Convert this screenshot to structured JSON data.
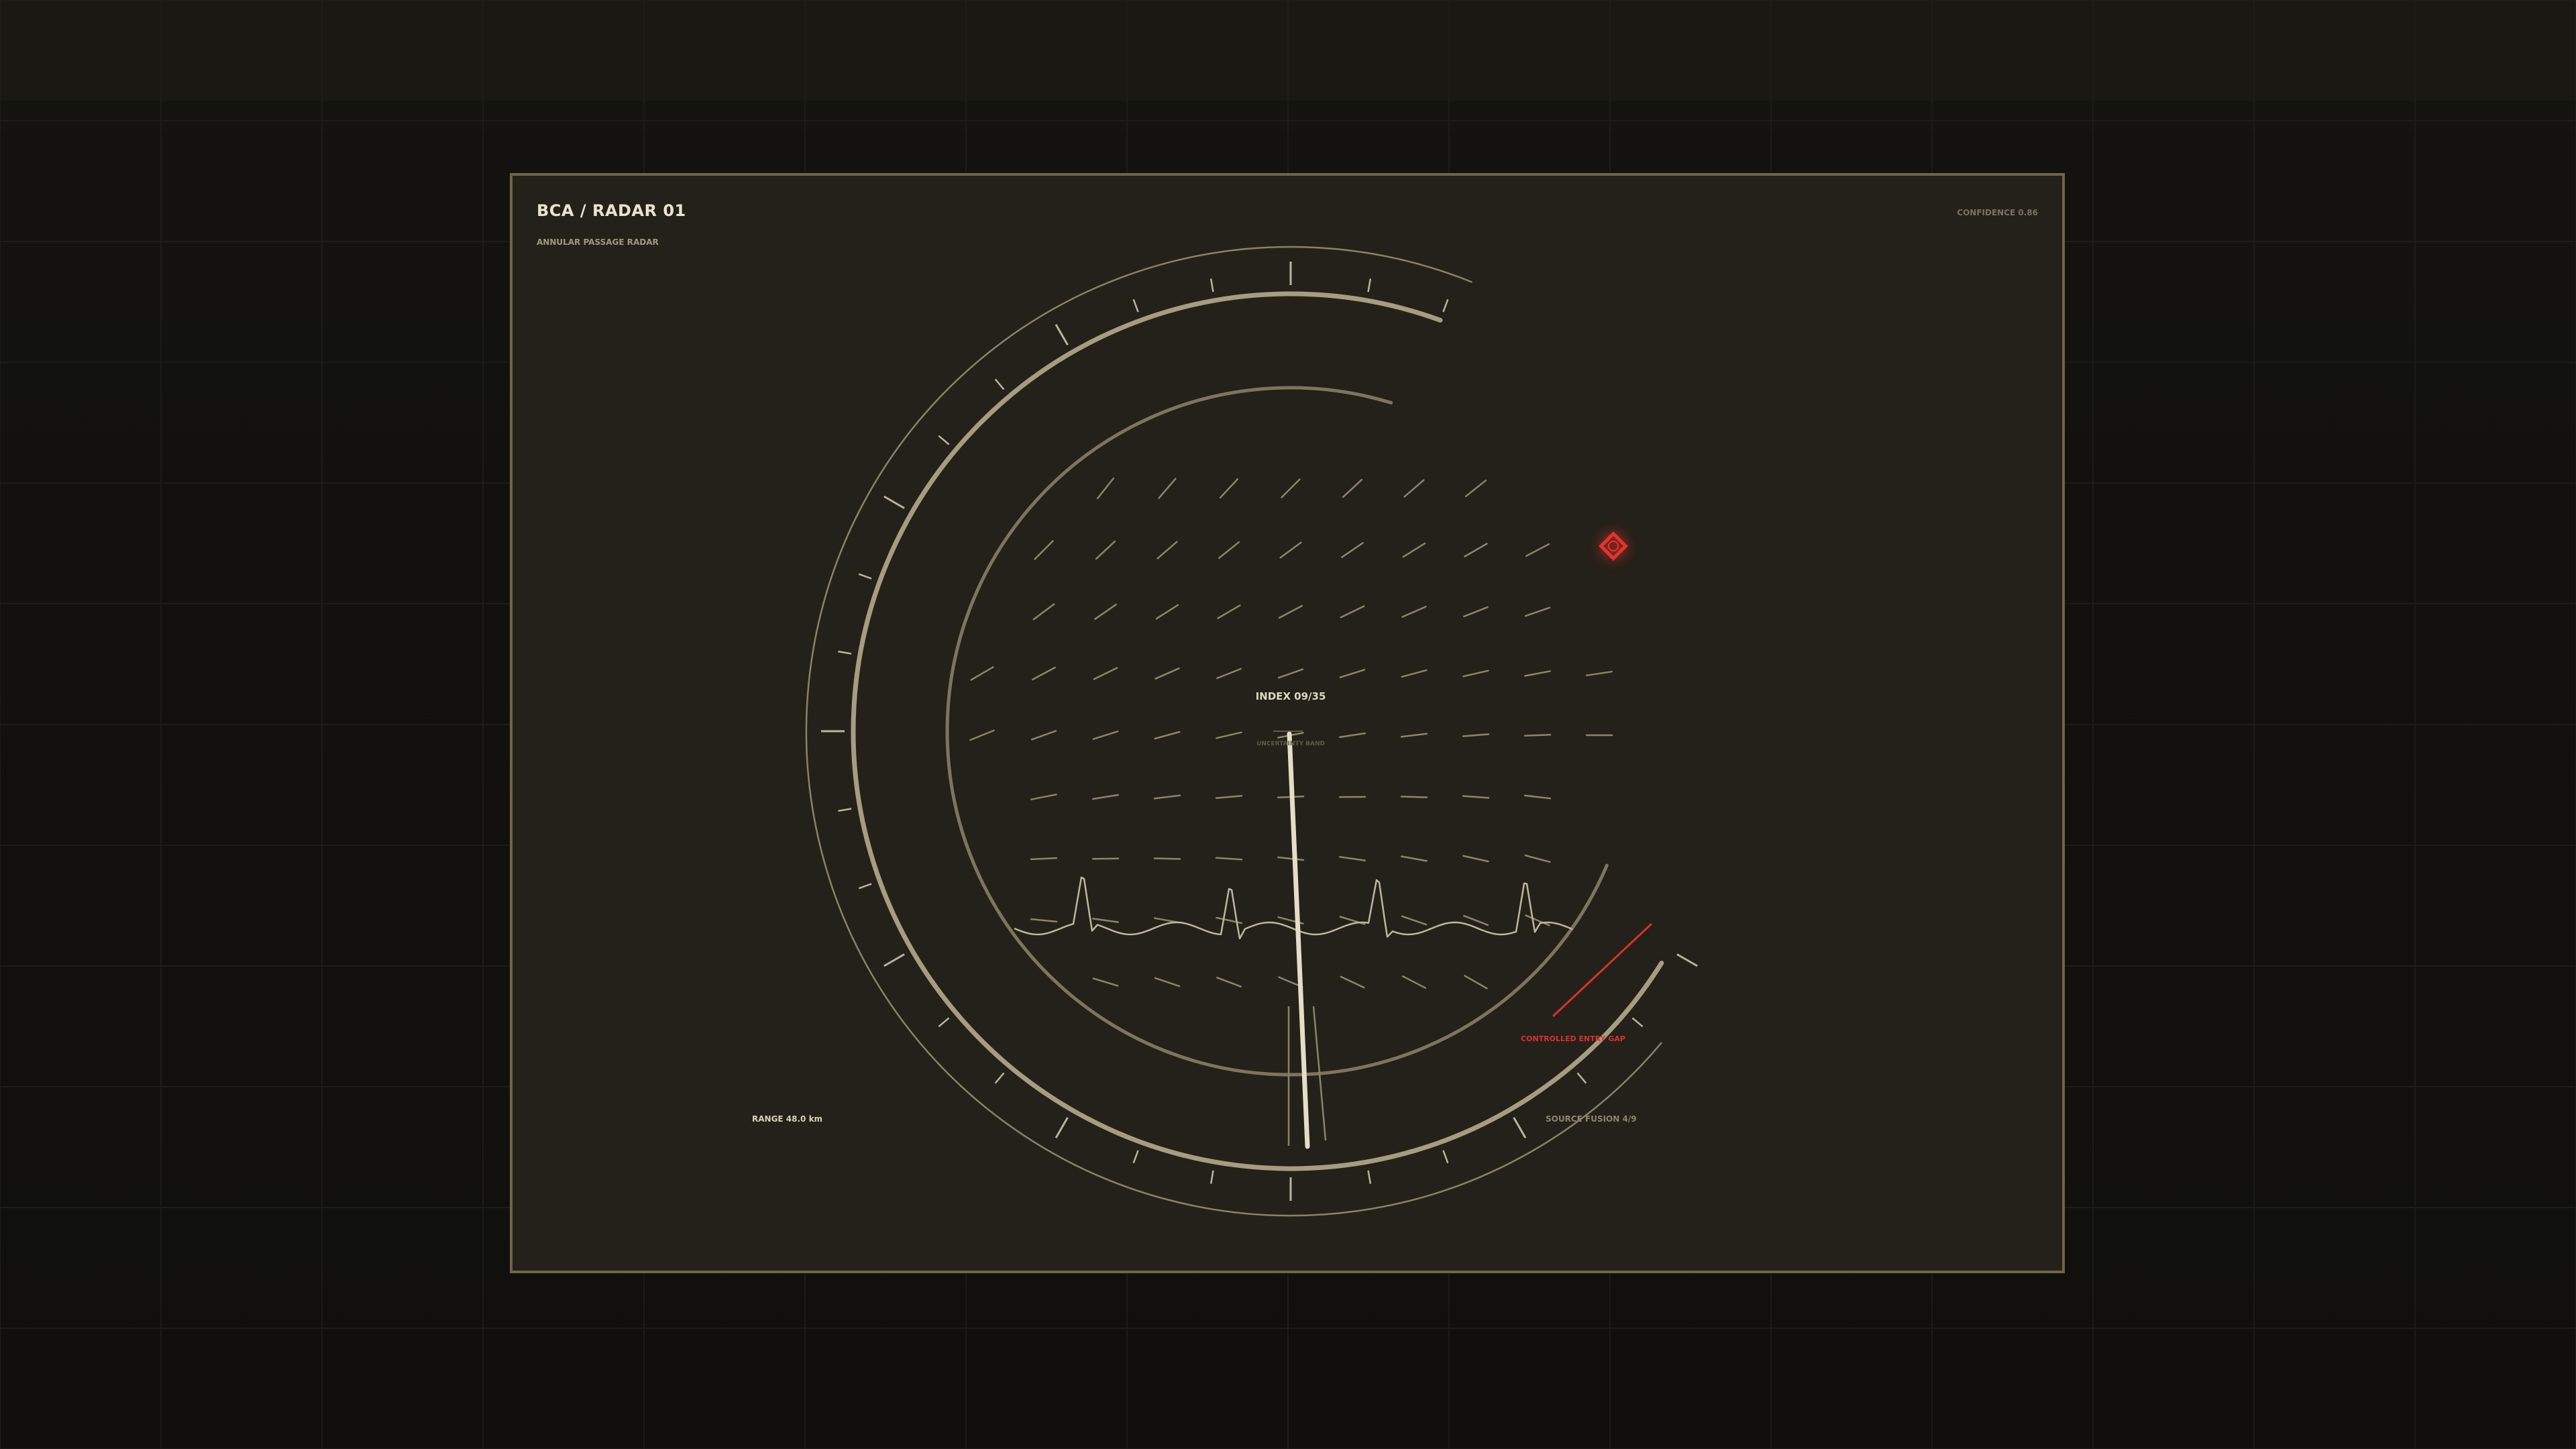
{
  "panel": {
    "title": "BCA / RADAR 01",
    "subtitle": "ANNULAR PASSAGE RADAR",
    "confidence": "CONFIDENCE 0.86"
  },
  "center": {
    "index_label": "INDEX 09/35",
    "uncertainty_label": "UNCERTAINTY BAND"
  },
  "readouts": {
    "range": "RANGE 48.0 km",
    "source_fusion": "SOURCE FUSION 4/9"
  },
  "alert": {
    "label": "CONTROLLED ENTRY GAP",
    "marker_icon": "target-diamond-icon"
  },
  "colors": {
    "accent": "#e8322c",
    "ring": "#a69d80",
    "text": "#e9e3cf",
    "muted": "#7d755f",
    "panel_border": "#6e6548"
  }
}
